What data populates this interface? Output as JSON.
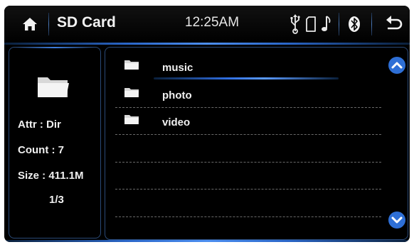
{
  "header": {
    "title": "SD Card",
    "time": "12:25AM"
  },
  "icons": {
    "home": "home-icon",
    "usb": "usb-icon",
    "sd": "sd-card-icon",
    "music": "music-note-icon",
    "bluetooth": "bluetooth-icon",
    "back": "back-arrow-icon",
    "folder": "folder-icon",
    "scroll_up": "chevron-up-icon",
    "scroll_down": "chevron-down-icon"
  },
  "info": {
    "attr": "Attr : Dir",
    "count": "Count : 7",
    "size": "Size : 411.1M",
    "page": "1/3"
  },
  "files": [
    {
      "name": "music",
      "type": "folder"
    },
    {
      "name": "photo",
      "type": "folder"
    },
    {
      "name": "video",
      "type": "folder"
    },
    {
      "name": "",
      "type": "empty"
    },
    {
      "name": "",
      "type": "empty"
    },
    {
      "name": "",
      "type": "empty"
    },
    {
      "name": "",
      "type": "empty"
    }
  ],
  "selected_index": 0,
  "colors": {
    "accent": "#3f7fe0",
    "scroll_button": "#2e6fd6",
    "background": "#000000",
    "text": "#f0f0f0"
  }
}
